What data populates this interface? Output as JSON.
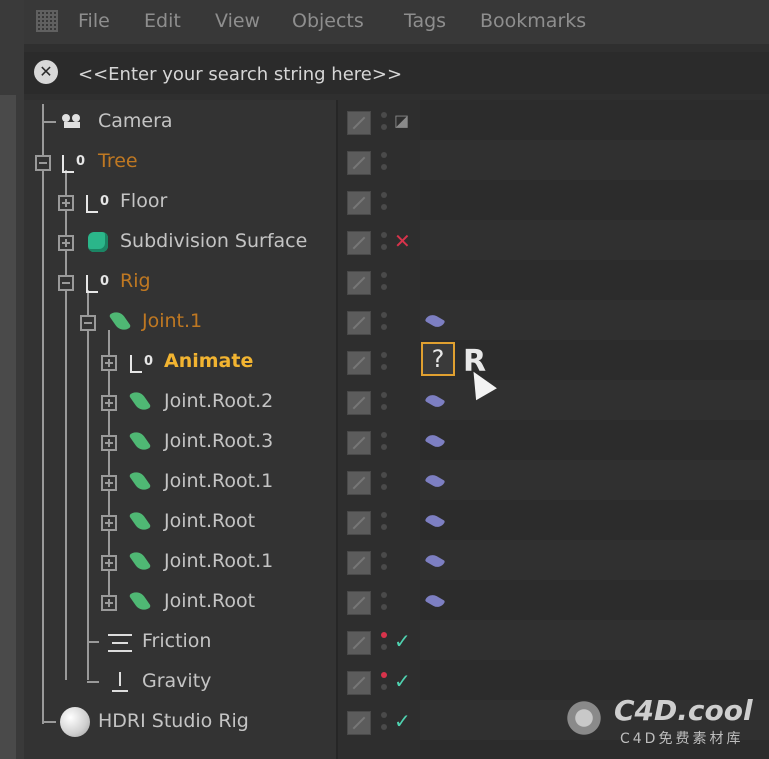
{
  "menu": {
    "items": [
      "File",
      "Edit",
      "View",
      "Objects",
      "Tags",
      "Bookmarks"
    ]
  },
  "search": {
    "placeholder": "<<Enter your search string here>>",
    "close_glyph": "✕"
  },
  "objects": [
    {
      "name": "Camera",
      "icon": "camera-icon",
      "status": "camera-tag"
    },
    {
      "name": "Tree",
      "icon": "null-object-icon",
      "expanded": true
    },
    {
      "name": "Floor",
      "icon": "null-object-icon"
    },
    {
      "name": "Subdivision Surface",
      "icon": "subdivision-surface-icon",
      "status": "cross"
    },
    {
      "name": "Rig",
      "icon": "null-object-icon",
      "expanded": true
    },
    {
      "name": "Joint.1",
      "icon": "joint-icon",
      "expanded": true,
      "tag": "ik-tag"
    },
    {
      "name": "Animate",
      "icon": "null-object-icon",
      "tag": "unknown-tag"
    },
    {
      "name": "Joint.Root.2",
      "icon": "joint-icon",
      "tag": "ik-tag"
    },
    {
      "name": "Joint.Root.3",
      "icon": "joint-icon",
      "tag": "ik-tag"
    },
    {
      "name": "Joint.Root.1",
      "icon": "joint-icon",
      "tag": "ik-tag"
    },
    {
      "name": "Joint.Root",
      "icon": "joint-icon",
      "tag": "ik-tag"
    },
    {
      "name": "Joint.Root.1",
      "icon": "joint-icon",
      "tag": "ik-tag"
    },
    {
      "name": "Joint.Root",
      "icon": "joint-icon",
      "tag": "ik-tag"
    },
    {
      "name": "Friction",
      "icon": "friction-icon",
      "status": "check"
    },
    {
      "name": "Gravity",
      "icon": "gravity-icon",
      "status": "check"
    },
    {
      "name": "HDRI Studio Rig",
      "icon": "sphere-icon",
      "status": "check"
    }
  ],
  "glyphs": {
    "check": "✓",
    "cross": "✕",
    "unknown_tag": "?",
    "dragged_tag": "R"
  },
  "watermark": {
    "main": "C4D.cool",
    "sub": "C4D免费素材库"
  }
}
